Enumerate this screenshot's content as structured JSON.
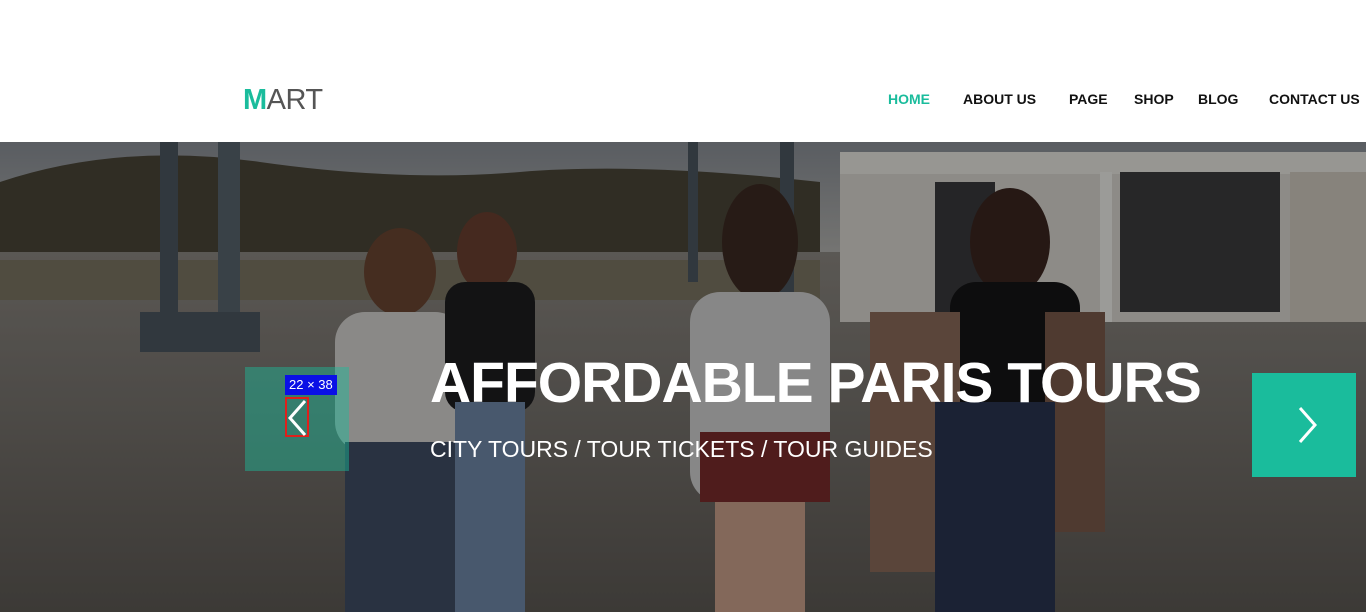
{
  "brand": {
    "first_letter": "M",
    "rest": "ART",
    "accent_color": "#1abc9c"
  },
  "nav": {
    "items": [
      {
        "label": "HOME",
        "active": true
      },
      {
        "label": "ABOUT US",
        "active": false
      },
      {
        "label": "PAGE",
        "active": false
      },
      {
        "label": "SHOP",
        "active": false
      },
      {
        "label": "BLOG",
        "active": false
      },
      {
        "label": "CONTACT US",
        "active": false
      }
    ]
  },
  "hero": {
    "title": "AFFORDABLE PARIS TOURS",
    "subtitle": "CITY TOURS / TOUR TICKETS / TOUR GUIDES",
    "image_alt": "four women walking on an empty lot"
  },
  "slider": {
    "prev_icon": "chevron-left-icon",
    "next_icon": "chevron-right-icon",
    "highlight_label": "22 × 38"
  }
}
